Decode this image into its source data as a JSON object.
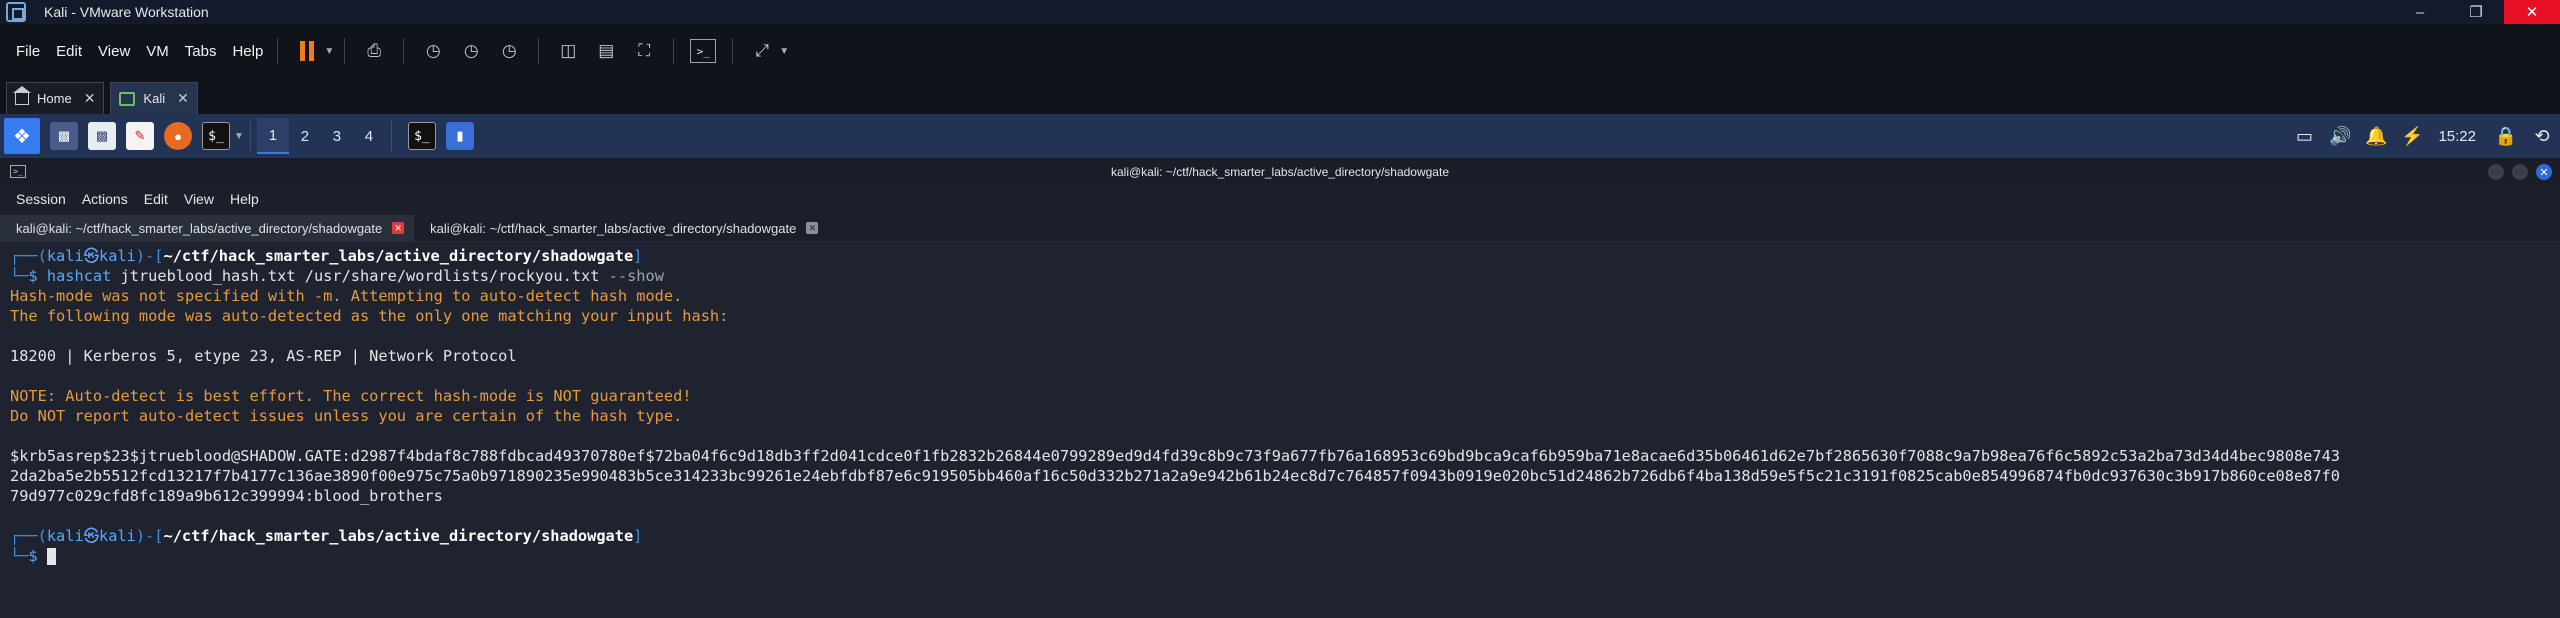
{
  "vmware": {
    "title": "Kali - VMware Workstation",
    "menu": [
      "File",
      "Edit",
      "View",
      "VM",
      "Tabs",
      "Help"
    ],
    "tabs": [
      {
        "label": "Home"
      },
      {
        "label": "Kali"
      }
    ]
  },
  "kali_panel": {
    "workspaces": [
      "1",
      "2",
      "3",
      "4"
    ],
    "clock": "15:22",
    "colors": {
      "panel": "#233356",
      "accent": "#367bf0"
    }
  },
  "terminal": {
    "window_title": "kali@kali: ~/ctf/hack_smarter_labs/active_directory/shadowgate",
    "menu": [
      "Session",
      "Actions",
      "Edit",
      "View",
      "Help"
    ],
    "tabs": [
      {
        "label": "kali@kali: ~/ctf/hack_smarter_labs/active_directory/shadowgate"
      },
      {
        "label": "kali@kali: ~/ctf/hack_smarter_labs/active_directory/shadowgate"
      }
    ],
    "prompt": {
      "top_left": "┌──(",
      "user": "kali",
      "at": "㉿",
      "host": "kali",
      "mid": ")-[",
      "path": "~/ctf/hack_smarter_labs/active_directory/shadowgate",
      "close": "]",
      "bottom": "└─",
      "dollar": "$"
    },
    "command": {
      "cmd": "hashcat",
      "args": "jtrueblood_hash.txt /usr/share/wordlists/rockyou.txt",
      "flag": "--show"
    },
    "output": {
      "warn1": "Hash-mode was not specified with -m. Attempting to auto-detect hash mode.",
      "warn2": "The following mode was auto-detected as the only one matching your input hash:",
      "mode": "18200 | Kerberos 5, etype 23, AS-REP | Network Protocol",
      "note1": "NOTE: Auto-detect is best effort. The correct hash-mode is NOT guaranteed!",
      "note2": "Do NOT report auto-detect issues unless you are certain of the hash type.",
      "hash_l1": "$krb5asrep$23$jtrueblood@SHADOW.GATE:d2987f4bdaf8c788fdbcad49370780ef$72ba04f6c9d18db3ff2d041cdce0f1fb2832b26844e0799289ed9d4fd39c8b9c73f9a677fb76a168953c69bd9bca9caf6b959ba71e8acae6d35b06461d62e7bf2865630f7088c9a7b98ea76f6c5892c53a2ba73d34d4bec9808e743",
      "hash_l2": "2da2ba5e2b5512fcd13217f7b4177c136ae3890f00e975c75a0b971890235e990483b5ce314233bc99261e24ebfdbf87e6c919505bb460af16c50d332b271a2a9e942b61b24ec8d7c764857f0943b0919e020bc51d24862b726db6f4ba138d59e5f5c21c3191f0825cab0e854996874fb0dc937630c3b917b860ce08e87f0",
      "hash_l3": "79d977c029cfd8fc189a9b612c399994:blood_brothers"
    }
  }
}
